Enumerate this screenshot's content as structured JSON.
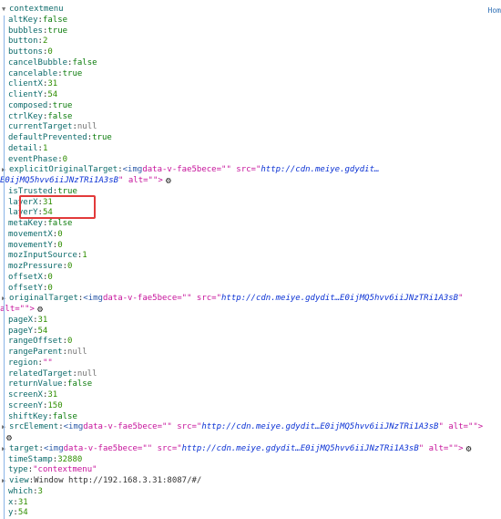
{
  "home_link": "Hom",
  "event_name": "contextmenu",
  "props": [
    {
      "type": "kv",
      "key": "altKey",
      "value": "false",
      "vtype": "b"
    },
    {
      "type": "kv",
      "key": "bubbles",
      "value": "true",
      "vtype": "b"
    },
    {
      "type": "kv",
      "key": "button",
      "value": "2",
      "vtype": "n"
    },
    {
      "type": "kv",
      "key": "buttons",
      "value": "0",
      "vtype": "n"
    },
    {
      "type": "kv",
      "key": "cancelBubble",
      "value": "false",
      "vtype": "b"
    },
    {
      "type": "kv",
      "key": "cancelable",
      "value": "true",
      "vtype": "b"
    },
    {
      "type": "kv",
      "key": "clientX",
      "value": "31",
      "vtype": "n"
    },
    {
      "type": "kv",
      "key": "clientY",
      "value": "54",
      "vtype": "n"
    },
    {
      "type": "kv",
      "key": "composed",
      "value": "true",
      "vtype": "b"
    },
    {
      "type": "kv",
      "key": "ctrlKey",
      "value": "false",
      "vtype": "b"
    },
    {
      "type": "kv",
      "key": "currentTarget",
      "value": "null",
      "vtype": "nl"
    },
    {
      "type": "kv",
      "key": "defaultPrevented",
      "value": "true",
      "vtype": "b"
    },
    {
      "type": "kv",
      "key": "detail",
      "value": "1",
      "vtype": "n"
    },
    {
      "type": "kv",
      "key": "eventPhase",
      "value": "0",
      "vtype": "n"
    },
    {
      "type": "el",
      "key": "explicitOriginalTarget",
      "tag": "<img",
      "attr": " data-v-fae5bece=\"\" src=\"",
      "src": "http://cdn.meiye.gdydit…",
      "cont": "E0ijMQ5hvv6iiJNzTRi1A3sB",
      "tail": "\" alt=\"\">",
      "gear": true,
      "wrap": true,
      "gearOnCont": true
    },
    {
      "type": "kv",
      "key": "isTrusted",
      "value": "true",
      "vtype": "b"
    },
    {
      "type": "kv",
      "key": "layerX",
      "value": "31",
      "vtype": "n"
    },
    {
      "type": "kv",
      "key": "layerY",
      "value": "54",
      "vtype": "n"
    },
    {
      "type": "kv",
      "key": "metaKey",
      "value": "false",
      "vtype": "b"
    },
    {
      "type": "kv",
      "key": "movementX",
      "value": "0",
      "vtype": "n"
    },
    {
      "type": "kv",
      "key": "movementY",
      "value": "0",
      "vtype": "n"
    },
    {
      "type": "kv",
      "key": "mozInputSource",
      "value": "1",
      "vtype": "n"
    },
    {
      "type": "kv",
      "key": "mozPressure",
      "value": "0",
      "vtype": "n"
    },
    {
      "type": "kv",
      "key": "offsetX",
      "value": "0",
      "vtype": "n"
    },
    {
      "type": "kv",
      "key": "offsetY",
      "value": "0",
      "vtype": "n"
    },
    {
      "type": "el",
      "key": "originalTarget",
      "tag": "<img",
      "attr": " data-v-fae5bece=\"\" src=\"",
      "src": "http://cdn.meiye.gdydit…E0ijMQ5hvv6iiJNzTRi1A3sB",
      "cont": "alt=\"\">",
      "tail": "\"",
      "gear": true,
      "wrap": true,
      "gearOnCont": true
    },
    {
      "type": "kv",
      "key": "pageX",
      "value": "31",
      "vtype": "n"
    },
    {
      "type": "kv",
      "key": "pageY",
      "value": "54",
      "vtype": "n"
    },
    {
      "type": "kv",
      "key": "rangeOffset",
      "value": "0",
      "vtype": "n"
    },
    {
      "type": "kv",
      "key": "rangeParent",
      "value": "null",
      "vtype": "nl"
    },
    {
      "type": "kv",
      "key": "region",
      "value": "\"\"",
      "vtype": "s"
    },
    {
      "type": "kv",
      "key": "relatedTarget",
      "value": "null",
      "vtype": "nl"
    },
    {
      "type": "kv",
      "key": "returnValue",
      "value": "false",
      "vtype": "b"
    },
    {
      "type": "kv",
      "key": "screenX",
      "value": "31",
      "vtype": "n"
    },
    {
      "type": "kv",
      "key": "screenY",
      "value": "150",
      "vtype": "n"
    },
    {
      "type": "kv",
      "key": "shiftKey",
      "value": "false",
      "vtype": "b"
    },
    {
      "type": "el",
      "key": "srcElement",
      "tag": "<img",
      "attr": " data-v-fae5bece=\"\" src=\"",
      "src": "http://cdn.meiye.gdydit…E0ijMQ5hvv6iiJNzTRi1A3sB",
      "tail": "\" alt=\"\">",
      "cont": "",
      "gear": true,
      "wrap": true,
      "gearOnCont": true
    },
    {
      "type": "el",
      "key": "target",
      "tag": "<img",
      "attr": " data-v-fae5bece=\"\" src=\"",
      "src": "http://cdn.meiye.gdydit…E0ijMQ5hvv6iiJNzTRi1A3sB",
      "tail": "\" alt=\"\">",
      "cont": "",
      "gear": true,
      "wrap": false,
      "gearOnCont": false
    },
    {
      "type": "kv",
      "key": "timeStamp",
      "value": "32880",
      "vtype": "n"
    },
    {
      "type": "kv",
      "key": "type",
      "value": "\"contextmenu\"",
      "vtype": "s"
    },
    {
      "type": "view",
      "key": "view",
      "value": "Window http://192.168.3.31:8087/#/"
    },
    {
      "type": "kv",
      "key": "which",
      "value": "3",
      "vtype": "n"
    },
    {
      "type": "kv",
      "key": "x",
      "value": "31",
      "vtype": "n"
    },
    {
      "type": "kv",
      "key": "y",
      "value": "54",
      "vtype": "n"
    }
  ]
}
